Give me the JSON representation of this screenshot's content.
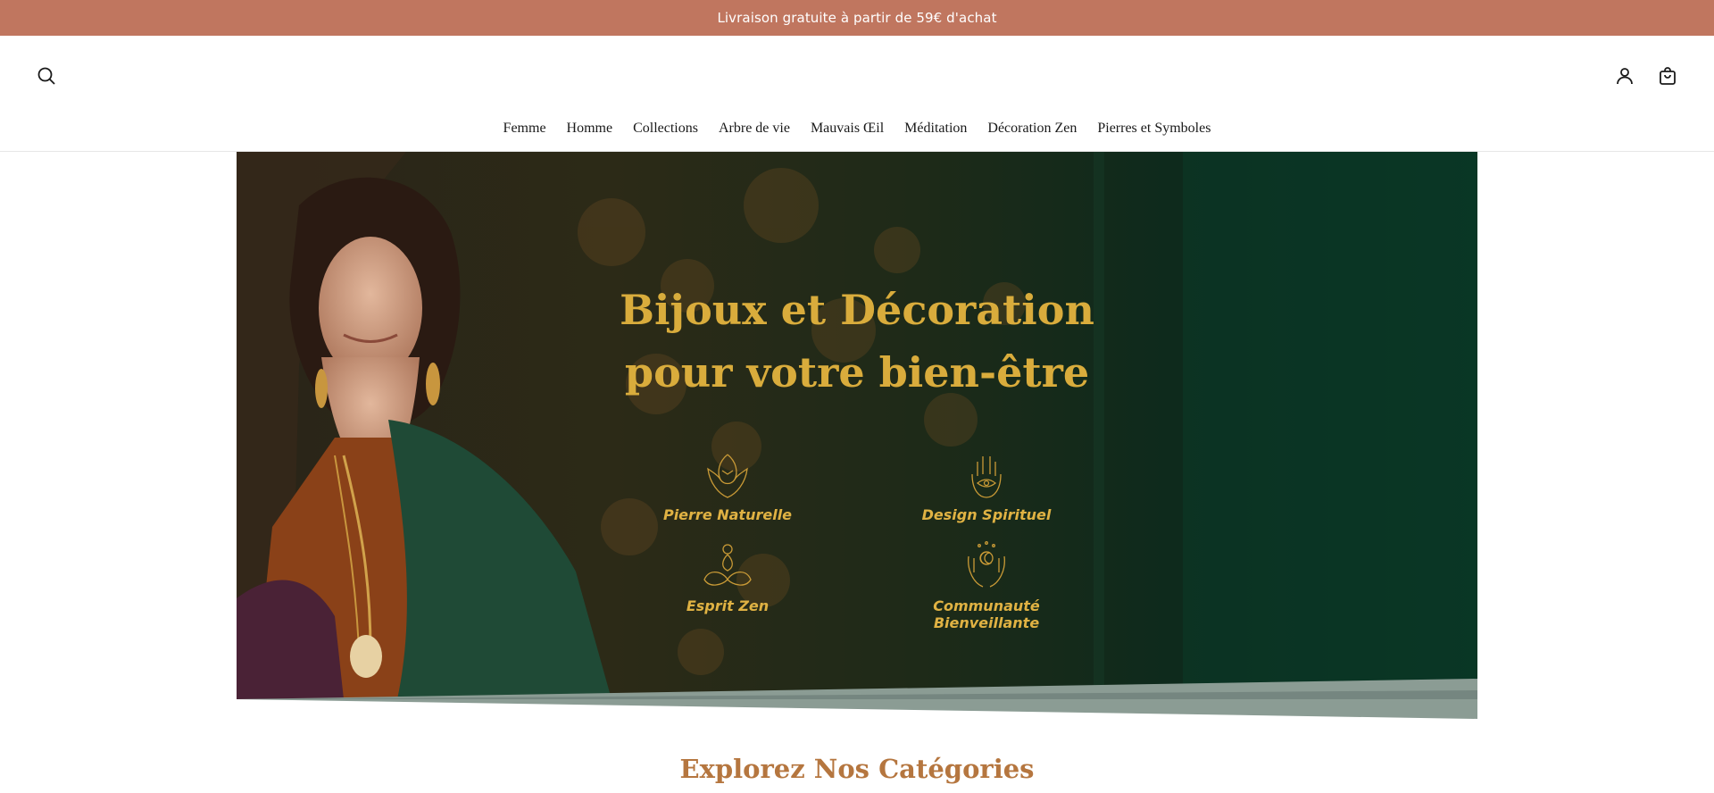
{
  "announcement": {
    "text": "Livraison gratuite à partir de 59€ d'achat"
  },
  "header": {
    "search_icon": "search-icon",
    "account_icon": "user-icon",
    "cart_icon": "shopping-bag-icon"
  },
  "nav": {
    "items": [
      {
        "label": "Femme"
      },
      {
        "label": "Homme"
      },
      {
        "label": "Collections"
      },
      {
        "label": "Arbre de vie"
      },
      {
        "label": "Mauvais Œil"
      },
      {
        "label": "Méditation"
      },
      {
        "label": "Décoration Zen"
      },
      {
        "label": "Pierres et Symboles"
      }
    ]
  },
  "hero": {
    "title_line1": "Bijoux et Décoration",
    "title_line2": "pour votre bien-être",
    "features": [
      {
        "label": "Pierre Naturelle",
        "icon": "lotus-hand-icon"
      },
      {
        "label": "Design Spirituel",
        "icon": "hamsa-icon"
      },
      {
        "label": "Esprit Zen",
        "icon": "meditation-icon"
      },
      {
        "label": "Communauté Bienveillante",
        "icon": "open-hands-icon"
      }
    ],
    "colors": {
      "gold": "#d9ac3c",
      "dark_green": "#083323"
    }
  },
  "sections": {
    "categories_title": "Explorez Nos Catégories"
  },
  "colors": {
    "announcement_bg": "#c0765f",
    "section_title": "#b5763f"
  }
}
